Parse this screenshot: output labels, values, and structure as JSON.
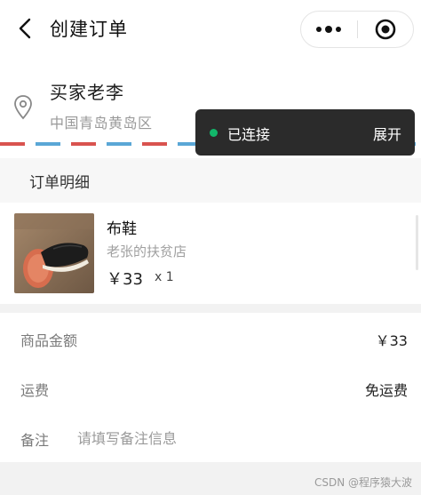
{
  "header": {
    "title": "创建订单",
    "back_icon": "back-arrow-icon",
    "more_icon": "more-dots-icon",
    "close_icon": "target-close-icon"
  },
  "address": {
    "name": "买家老李",
    "region": "中国青岛黄岛区",
    "icon": "location-pin-icon"
  },
  "toast": {
    "status": "已连接",
    "expand": "展开",
    "status_color": "#12b76a"
  },
  "order": {
    "section_title": "订单明细",
    "product": {
      "name": "布鞋",
      "shop": "老张的扶贫店",
      "price": "￥33",
      "quantity": "x 1"
    }
  },
  "summary": {
    "amount_label": "商品金额",
    "amount_value": "￥33",
    "shipping_label": "运费",
    "shipping_value": "免运费",
    "note_label": "备注",
    "note_placeholder": "请填写备注信息"
  },
  "watermark": "CSDN @程序猿大波"
}
